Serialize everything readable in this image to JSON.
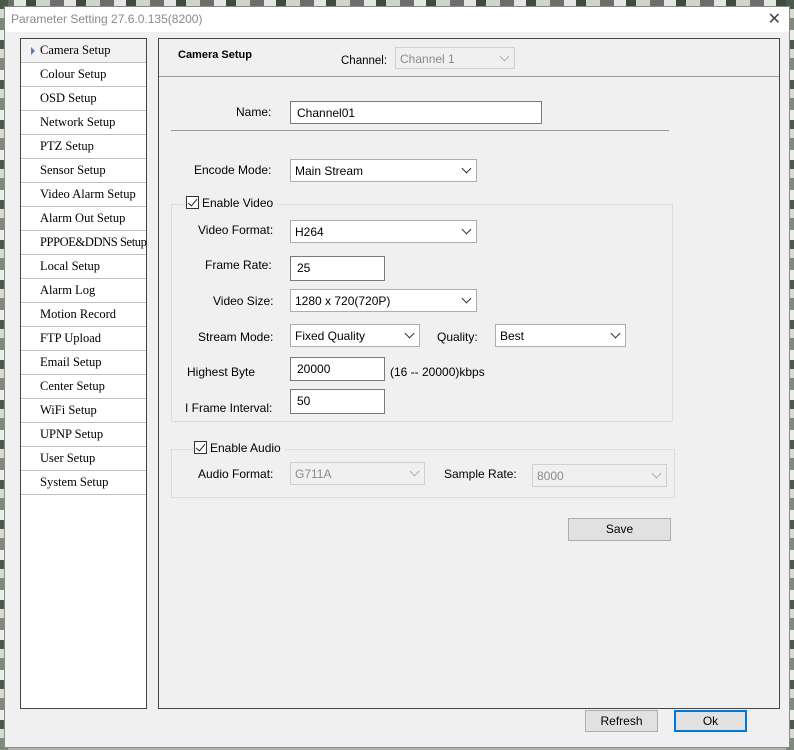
{
  "window": {
    "title": "Parameter Setting 27.6.0.135(8200)"
  },
  "sidebar": {
    "items": [
      {
        "label": "Camera Setup",
        "active": true
      },
      {
        "label": "Colour Setup"
      },
      {
        "label": "OSD Setup"
      },
      {
        "label": "Network Setup"
      },
      {
        "label": "PTZ Setup"
      },
      {
        "label": "Sensor Setup"
      },
      {
        "label": "Video Alarm Setup"
      },
      {
        "label": "Alarm Out Setup"
      },
      {
        "label": "PPPOE&DDNS Setup"
      },
      {
        "label": "Local Setup"
      },
      {
        "label": "Alarm Log"
      },
      {
        "label": "Motion Record"
      },
      {
        "label": "FTP Upload"
      },
      {
        "label": "Email Setup"
      },
      {
        "label": "Center Setup"
      },
      {
        "label": "WiFi Setup"
      },
      {
        "label": "UPNP Setup"
      },
      {
        "label": "User Setup"
      },
      {
        "label": "System Setup"
      }
    ]
  },
  "camera": {
    "section_title": "Camera Setup",
    "channel_label": "Channel:",
    "channel_value": "Channel 1",
    "name_label": "Name:",
    "name_value": "Channel01",
    "encode_label": "Encode Mode:",
    "encode_value": "Main Stream",
    "enable_video_label": "Enable Video",
    "enable_video_checked": true,
    "video_format_label": "Video Format:",
    "video_format_value": "H264",
    "frame_rate_label": "Frame Rate:",
    "frame_rate_value": "25",
    "video_size_label": "Video Size:",
    "video_size_value": "1280 x 720(720P)",
    "stream_mode_label": "Stream Mode:",
    "stream_mode_value": "Fixed Quality",
    "quality_label": "Quality:",
    "quality_value": "Best",
    "highest_byte_label": "Highest Byte",
    "highest_byte_value": "20000",
    "highest_byte_range": "(16 -- 20000)kbps",
    "iframe_label": "I Frame Interval:",
    "iframe_value": "50",
    "enable_audio_label": "Enable Audio",
    "enable_audio_checked": true,
    "audio_format_label": "Audio Format:",
    "audio_format_value": "G711A",
    "sample_rate_label": "Sample Rate:",
    "sample_rate_value": "8000",
    "save_label": "Save"
  },
  "footer": {
    "refresh_label": "Refresh",
    "ok_label": "Ok"
  },
  "icons": {
    "close": "close-icon",
    "dropdown": "chevron-down-icon",
    "active_marker": "triangle-right-icon",
    "check": "checkmark-icon"
  }
}
